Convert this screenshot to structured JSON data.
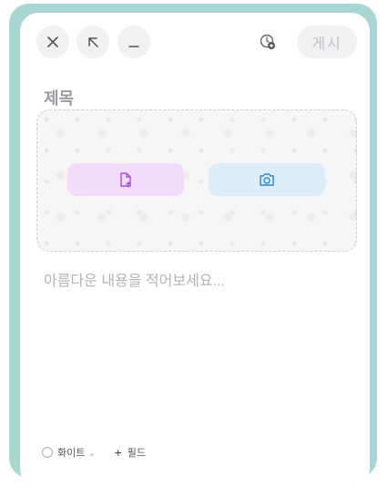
{
  "header": {
    "close_icon": "close-icon",
    "expand_icon": "expand-icon",
    "minimize_icon": "minimize-icon",
    "timer_icon": "schedule-icon",
    "post_label": "게시"
  },
  "editor": {
    "title_placeholder": "제목",
    "body_placeholder": "아름다운 내용을 적어보세요..."
  },
  "media": {
    "file_button_icon": "file-upload-icon",
    "camera_button_icon": "camera-icon",
    "colors": {
      "file_bg": "#f1ddfb",
      "camera_bg": "#dcecf9",
      "file_icon": "#a450d8",
      "camera_icon": "#2b87cf"
    }
  },
  "footer": {
    "color_label": "화이트",
    "add_field_label": "필드"
  },
  "colors": {
    "accent_teal": "#a8d7d3",
    "post_text": "#c2c2c6"
  }
}
